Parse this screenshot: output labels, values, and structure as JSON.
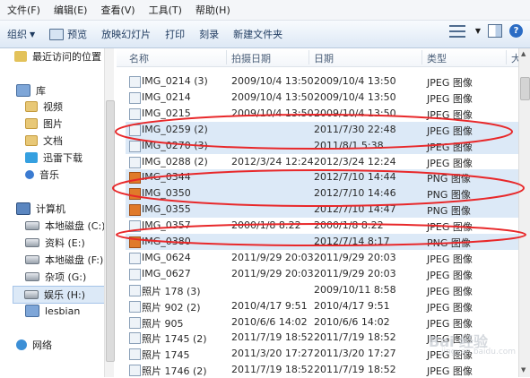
{
  "menu": [
    "文件(F)",
    "编辑(E)",
    "查看(V)",
    "工具(T)",
    "帮助(H)"
  ],
  "toolbar": {
    "organize": "组织",
    "preview": "预览",
    "slideshow": "放映幻灯片",
    "print": "打印",
    "burn": "刻录",
    "new_folder": "新建文件夹",
    "help_label": "?"
  },
  "nav": {
    "recent": "最近访问的位置",
    "libraries": "库",
    "videos": "视频",
    "pictures": "图片",
    "documents": "文档",
    "thunder": "迅雷下载",
    "music": "音乐",
    "computer": "计算机",
    "drive_c": "本地磁盘 (C:)",
    "drive_e": "资料 (E:)",
    "drive_f": "本地磁盘 (F:)",
    "drive_g": "杂项 (G:)",
    "drive_h": "娱乐 (H:)",
    "lesbian": "lesbian",
    "network": "网络"
  },
  "columns": {
    "name": "名称",
    "taken": "拍摄日期",
    "date": "日期",
    "type": "类型",
    "more": "大"
  },
  "files": [
    {
      "name": "IMG_0214 (3)",
      "taken": "2009/10/4 13:50",
      "date": "2009/10/4 13:50",
      "type": "JPEG 图像",
      "kind": "jpeg",
      "selected": false
    },
    {
      "name": "IMG_0214",
      "taken": "2009/10/4 13:50",
      "date": "2009/10/4 13:50",
      "type": "JPEG 图像",
      "kind": "jpeg",
      "selected": false
    },
    {
      "name": "IMG_0215",
      "taken": "2009/10/4 13:50",
      "date": "2009/10/4 13:50",
      "type": "JPEG 图像",
      "kind": "jpeg",
      "selected": false
    },
    {
      "name": "IMG_0259 (2)",
      "taken": "",
      "date": "2011/7/30 22:48",
      "type": "JPEG 图像",
      "kind": "jpeg",
      "selected": true
    },
    {
      "name": "IMG_0270 (3)",
      "taken": "",
      "date": "2011/8/1 5:38",
      "type": "JPEG 图像",
      "kind": "jpeg",
      "selected": true
    },
    {
      "name": "IMG_0288 (2)",
      "taken": "2012/3/24 12:24",
      "date": "2012/3/24 12:24",
      "type": "JPEG 图像",
      "kind": "jpeg",
      "selected": false
    },
    {
      "name": "IMG_0344",
      "taken": "",
      "date": "2012/7/10 14:44",
      "type": "PNG 图像",
      "kind": "png",
      "selected": true
    },
    {
      "name": "IMG_0350",
      "taken": "",
      "date": "2012/7/10 14:46",
      "type": "PNG 图像",
      "kind": "png",
      "selected": true
    },
    {
      "name": "IMG_0355",
      "taken": "",
      "date": "2012/7/10 14:47",
      "type": "PNG 图像",
      "kind": "png",
      "selected": true
    },
    {
      "name": "IMG_0357",
      "taken": "2000/1/8 8:22",
      "date": "2000/1/8 8:22",
      "type": "JPEG 图像",
      "kind": "jpeg",
      "selected": false
    },
    {
      "name": "IMG_0380",
      "taken": "",
      "date": "2012/7/14 8:17",
      "type": "PNG 图像",
      "kind": "png",
      "selected": true
    },
    {
      "name": "IMG_0624",
      "taken": "2011/9/29 20:03",
      "date": "2011/9/29 20:03",
      "type": "JPEG 图像",
      "kind": "jpeg",
      "selected": false
    },
    {
      "name": "IMG_0627",
      "taken": "2011/9/29 20:03",
      "date": "2011/9/29 20:03",
      "type": "JPEG 图像",
      "kind": "jpeg",
      "selected": false
    },
    {
      "name": "照片 178 (3)",
      "taken": "",
      "date": "2009/10/11 8:58",
      "type": "JPEG 图像",
      "kind": "jpeg",
      "selected": false
    },
    {
      "name": "照片 902 (2)",
      "taken": "2010/4/17 9:51",
      "date": "2010/4/17 9:51",
      "type": "JPEG 图像",
      "kind": "jpeg",
      "selected": false
    },
    {
      "name": "照片 905",
      "taken": "2010/6/6 14:02",
      "date": "2010/6/6 14:02",
      "type": "JPEG 图像",
      "kind": "jpeg",
      "selected": false
    },
    {
      "name": "照片 1745 (2)",
      "taken": "2011/7/19 18:52",
      "date": "2011/7/19 18:52",
      "type": "JPEG 图像",
      "kind": "jpeg",
      "selected": false
    },
    {
      "name": "照片 1745",
      "taken": "2011/3/20 17:27",
      "date": "2011/3/20 17:27",
      "type": "JPEG 图像",
      "kind": "jpeg",
      "selected": false
    },
    {
      "name": "照片 1746 (2)",
      "taken": "2011/7/19 18:52",
      "date": "2011/7/19 18:52",
      "type": "JPEG 图像",
      "kind": "jpeg",
      "selected": false
    }
  ],
  "annotation_color": "#e8282a",
  "selection_color": "#dce9f7",
  "watermark": "Bai 经验",
  "watermark_sub": "jingyan.baidu.com"
}
